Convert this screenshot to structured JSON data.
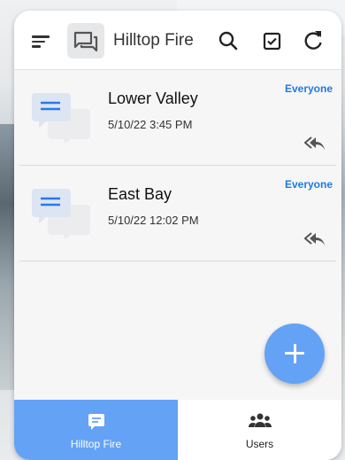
{
  "appbar": {
    "title": "Hilltop Fire",
    "icons": [
      "menu-icon",
      "chat-icon",
      "search-icon",
      "checkbox-icon",
      "refresh-icon"
    ]
  },
  "messages": [
    {
      "name": "Lower Valley",
      "time": "5/10/22  3:45 PM",
      "audience": "Everyone"
    },
    {
      "name": "East Bay",
      "time": "5/10/22  12:02 PM",
      "audience": "Everyone"
    }
  ],
  "fab": {
    "icon": "plus-icon"
  },
  "bottom_nav": {
    "tabs": [
      {
        "label": "Hilltop Fire",
        "icon": "message-icon",
        "active": true
      },
      {
        "label": "Users",
        "icon": "users-icon",
        "active": false
      }
    ]
  },
  "colors": {
    "accent": "#64a2f5",
    "link": "#1e7be0"
  }
}
